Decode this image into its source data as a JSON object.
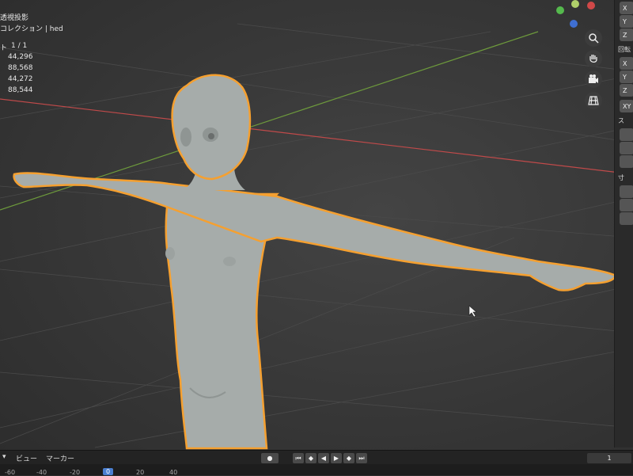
{
  "overlay": {
    "view_mode": "透視投影",
    "collection": "コレクション | hed",
    "stats": {
      "label": "ト",
      "objects": "1 / 1",
      "vertices": "44,296",
      "edges": "88,568",
      "faces": "44,272",
      "triangles": "88,544"
    }
  },
  "npanel": {
    "x_label": "X",
    "y_label": "Y",
    "z_label": "Z",
    "rotation_label": "回転",
    "rx_label": "X",
    "ry_label": "Y",
    "rz_label": "Z",
    "mode_label": "XY",
    "scale_label": "ス",
    "dim_label": "寸"
  },
  "nav_gizmo": {
    "icons": [
      "zoom-icon",
      "hand-icon",
      "camera-icon",
      "grid-icon"
    ]
  },
  "timeline": {
    "view_menu": "ビュー",
    "marker_menu": "マーカー",
    "current_frame": "1",
    "frame_ticks": [
      "-60",
      "-40",
      "-20",
      "0",
      "20",
      "40"
    ]
  },
  "colors": {
    "background": "#393939",
    "selection_outline": "#f5a030",
    "axis_x": "#c04a4a",
    "axis_y": "#6d9a3c",
    "mesh": "#a6acaa"
  }
}
